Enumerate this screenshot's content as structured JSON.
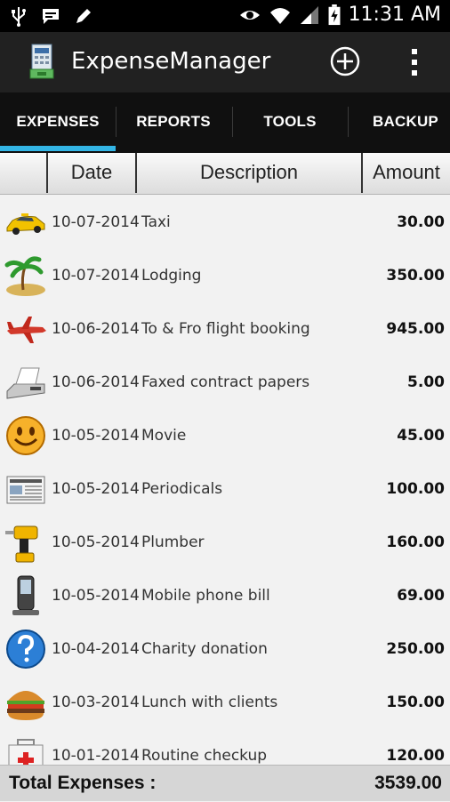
{
  "status_bar": {
    "time": "11:31 AM"
  },
  "app": {
    "title": "ExpenseManager"
  },
  "tabs": [
    {
      "label": "EXPENSES",
      "active": true
    },
    {
      "label": "REPORTS",
      "active": false
    },
    {
      "label": "TOOLS",
      "active": false
    },
    {
      "label": "BACKUP",
      "active": false
    }
  ],
  "accent_color": "#33b5e5",
  "table": {
    "headers": {
      "date": "Date",
      "description": "Description",
      "amount": "Amount"
    },
    "rows": [
      {
        "icon": "taxi-icon",
        "date": "10-07-2014",
        "description": "Taxi",
        "amount": "30.00"
      },
      {
        "icon": "palm-island-icon",
        "date": "10-07-2014",
        "description": "Lodging",
        "amount": "350.00"
      },
      {
        "icon": "airplane-icon",
        "date": "10-06-2014",
        "description": "To & Fro flight booking",
        "amount": "945.00"
      },
      {
        "icon": "fax-machine-icon",
        "date": "10-06-2014",
        "description": "Faxed contract  papers",
        "amount": "5.00"
      },
      {
        "icon": "smiley-icon",
        "date": "10-05-2014",
        "description": "Movie",
        "amount": "45.00"
      },
      {
        "icon": "newspaper-icon",
        "date": "10-05-2014",
        "description": "Periodicals",
        "amount": "100.00"
      },
      {
        "icon": "drill-icon",
        "date": "10-05-2014",
        "description": "Plumber",
        "amount": "160.00"
      },
      {
        "icon": "mobile-phone-icon",
        "date": "10-05-2014",
        "description": "Mobile phone bill",
        "amount": "69.00"
      },
      {
        "icon": "question-icon",
        "date": "10-04-2014",
        "description": "Charity donation",
        "amount": "250.00"
      },
      {
        "icon": "burger-icon",
        "date": "10-03-2014",
        "description": "Lunch with clients",
        "amount": "150.00"
      },
      {
        "icon": "first-aid-kit-icon",
        "date": "10-01-2014",
        "description": "Routine checkup",
        "amount": "120.00"
      }
    ]
  },
  "footer": {
    "label": "Total Expenses :",
    "total": "3539.00"
  }
}
